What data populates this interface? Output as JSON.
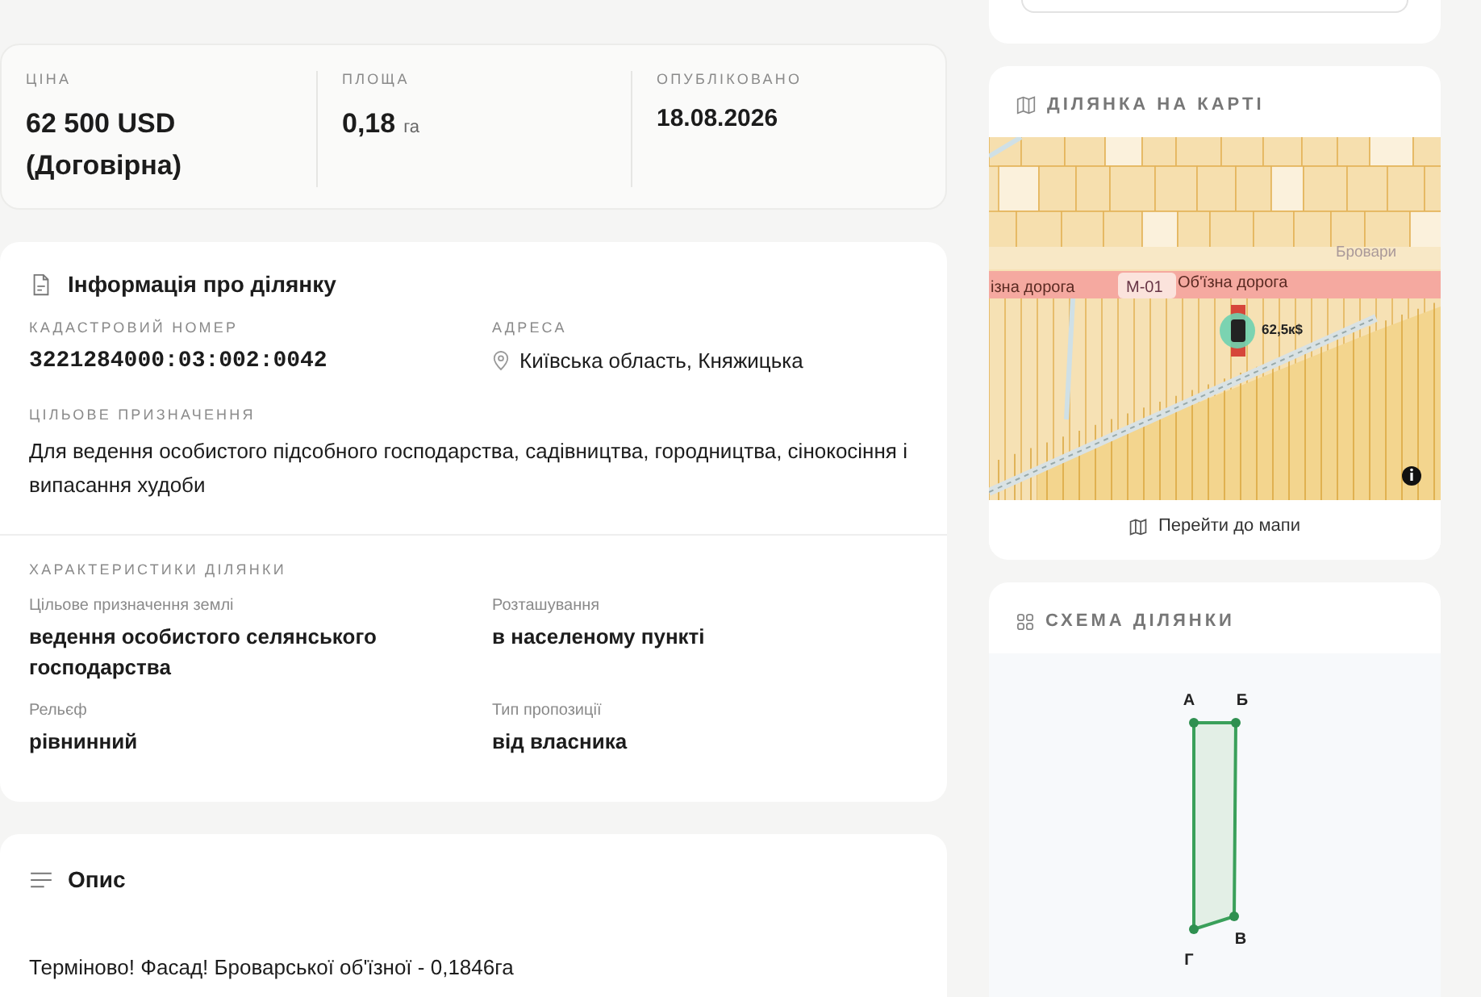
{
  "summary": {
    "items": [
      {
        "label": "ЦІНА",
        "value": "62 500 USD (Договірна)"
      },
      {
        "label": "ПЛОЩА",
        "value": "0,18",
        "unit": "га"
      },
      {
        "label": "ОПУБЛІКОВАНО",
        "value": "18.08.2026"
      }
    ]
  },
  "info": {
    "title": "Інформація про ділянку",
    "cadastral": {
      "label": "КАДАСТРОВИЙ НОМЕР",
      "value": "3221284000:03:002:0042"
    },
    "address": {
      "label": "АДРЕСА",
      "value": "Київська область, Княжицька"
    },
    "purpose": {
      "label": "ЦІЛЬОВЕ ПРИЗНАЧЕННЯ",
      "value": "Для ведення особистого підсобного господарства, садівництва, городництва, сінокосіння і випасання худоби"
    },
    "characteristics": {
      "title": "ХАРАКТЕРИСТИКИ ДІЛЯНКИ",
      "items": [
        {
          "label": "Цільове призначення землі",
          "value": "ведення особистого селянського господарства"
        },
        {
          "label": "Розташування",
          "value": "в населеному пункті"
        },
        {
          "label": "Рельєф",
          "value": "рівнинний"
        },
        {
          "label": "Тип пропозиції",
          "value": "від власника"
        }
      ]
    }
  },
  "description": {
    "title": "Опис",
    "text": "Терміново! Фасад! Броварської об'їзної - 0,1846га"
  },
  "map_card": {
    "title": "ДІЛЯНКА НА КАРТІ",
    "labels": {
      "city": "Бровари",
      "road_left": "ізна дорога",
      "road_code": "M-01",
      "road": "Об'їзна дорога",
      "price": "62,5к$"
    },
    "link": "Перейти до мапи"
  },
  "scheme_card": {
    "title": "СХЕМА ДІЛЯНКИ",
    "vertices": [
      "А",
      "Б",
      "В",
      "Г"
    ]
  }
}
